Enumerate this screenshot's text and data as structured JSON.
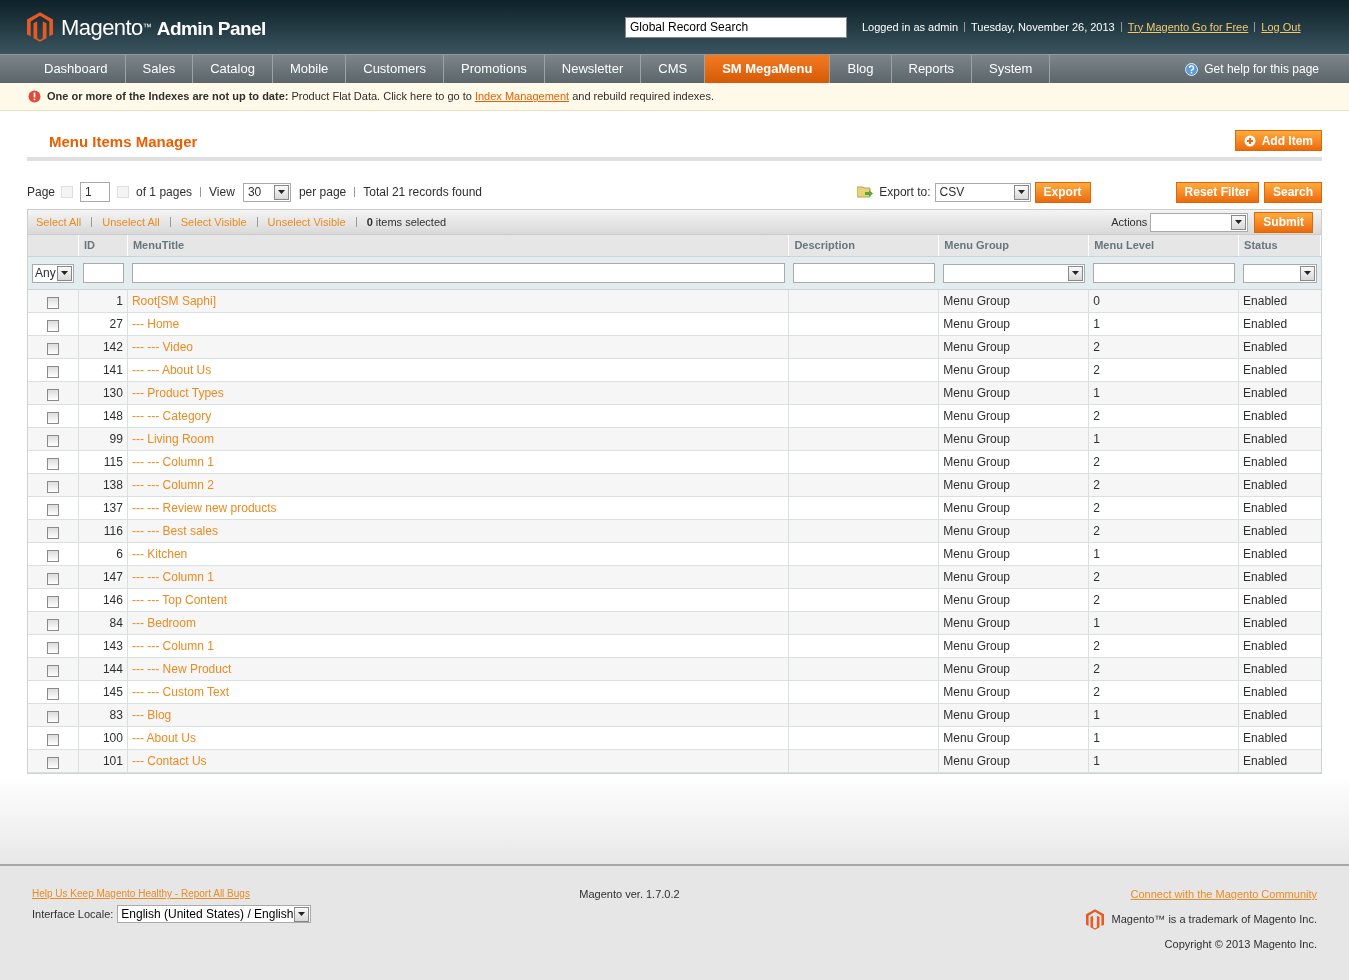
{
  "header": {
    "logo_text": "Magento",
    "logo_mark": "™",
    "logo_suffix": "Admin Panel",
    "search": {
      "value": "Global Record Search"
    },
    "user": "Logged in as admin",
    "date": "Tuesday, November 26, 2013",
    "links": [
      "Try Magento Go for Free",
      "Log Out"
    ]
  },
  "nav": {
    "items": [
      {
        "label": "Dashboard",
        "selected": false
      },
      {
        "label": "Sales",
        "selected": false
      },
      {
        "label": "Catalog",
        "selected": false
      },
      {
        "label": "Mobile",
        "selected": false
      },
      {
        "label": "Customers",
        "selected": false
      },
      {
        "label": "Promotions",
        "selected": false
      },
      {
        "label": "Newsletter",
        "selected": false
      },
      {
        "label": "CMS",
        "selected": false
      },
      {
        "label": "SM MegaMenu",
        "selected": true
      },
      {
        "label": "Blog",
        "selected": false
      },
      {
        "label": "Reports",
        "selected": false
      },
      {
        "label": "System",
        "selected": false
      }
    ],
    "help": "Get help for this page"
  },
  "notice": {
    "bold": "One or more of the Indexes are not up to date:",
    "text": "Product Flat Data. Click here to go to",
    "link": "Index Management",
    "after": "and rebuild required indexes."
  },
  "page_title": "Menu Items Manager",
  "add_button": "Add Item",
  "pager": {
    "page_label": "Page",
    "page": "1",
    "of_pages": "of 1 pages",
    "view_label": "View",
    "per_page": "30",
    "per_page_label": "per page",
    "total": "Total 21 records found"
  },
  "export": {
    "label": "Export to:",
    "format": "CSV",
    "button": "Export"
  },
  "filter_buttons": [
    "Reset Filter",
    "Search"
  ],
  "massaction": {
    "links": [
      "Select All",
      "Unselect All",
      "Select Visible",
      "Unselect Visible"
    ],
    "count": "0",
    "count_label": "items selected",
    "actions_label": "Actions",
    "submit": "Submit"
  },
  "table": {
    "columns": [
      "ID",
      "MenuTitle",
      "Description",
      "Menu Group",
      "Menu Level",
      "Status"
    ],
    "any_filter": "Any",
    "rows": [
      {
        "id": "1",
        "title": "Root[SM Saphi]",
        "group": "Menu Group",
        "level": "0",
        "status": "Enabled",
        "checked": false
      },
      {
        "id": "27",
        "title": "--- Home",
        "group": "Menu Group",
        "level": "1",
        "status": "Enabled",
        "checked": false
      },
      {
        "id": "142",
        "title": "--- --- Video",
        "group": "Menu Group",
        "level": "2",
        "status": "Enabled",
        "checked": false
      },
      {
        "id": "141",
        "title": "--- --- About Us",
        "group": "Menu Group",
        "level": "2",
        "status": "Enabled",
        "checked": false
      },
      {
        "id": "130",
        "title": "--- Product Types",
        "group": "Menu Group",
        "level": "1",
        "status": "Enabled",
        "checked": false
      },
      {
        "id": "148",
        "title": "--- --- Category",
        "group": "Menu Group",
        "level": "2",
        "status": "Enabled",
        "checked": false
      },
      {
        "id": "99",
        "title": "--- Living Room",
        "group": "Menu Group",
        "level": "1",
        "status": "Enabled",
        "checked": false
      },
      {
        "id": "115",
        "title": "--- --- Column 1",
        "group": "Menu Group",
        "level": "2",
        "status": "Enabled",
        "checked": false
      },
      {
        "id": "138",
        "title": "--- --- Column 2",
        "group": "Menu Group",
        "level": "2",
        "status": "Enabled",
        "checked": false
      },
      {
        "id": "137",
        "title": "--- --- Review new products",
        "group": "Menu Group",
        "level": "2",
        "status": "Enabled",
        "checked": false
      },
      {
        "id": "116",
        "title": "--- --- Best sales",
        "group": "Menu Group",
        "level": "2",
        "status": "Enabled",
        "checked": false
      },
      {
        "id": "6",
        "title": "--- Kitchen",
        "group": "Menu Group",
        "level": "1",
        "status": "Enabled",
        "checked": false
      },
      {
        "id": "147",
        "title": "--- --- Column 1",
        "group": "Menu Group",
        "level": "2",
        "status": "Enabled",
        "checked": false
      },
      {
        "id": "146",
        "title": "--- --- Top Content",
        "group": "Menu Group",
        "level": "2",
        "status": "Enabled",
        "checked": false
      },
      {
        "id": "84",
        "title": "--- Bedroom",
        "group": "Menu Group",
        "level": "1",
        "status": "Enabled",
        "checked": false
      },
      {
        "id": "143",
        "title": "--- --- Column 1",
        "group": "Menu Group",
        "level": "2",
        "status": "Enabled",
        "checked": false
      },
      {
        "id": "144",
        "title": "--- --- New Product",
        "group": "Menu Group",
        "level": "2",
        "status": "Enabled",
        "checked": false
      },
      {
        "id": "145",
        "title": "--- --- Custom Text",
        "group": "Menu Group",
        "level": "2",
        "status": "Enabled",
        "checked": false
      },
      {
        "id": "83",
        "title": "--- Blog",
        "group": "Menu Group",
        "level": "1",
        "status": "Enabled",
        "checked": false
      },
      {
        "id": "100",
        "title": "--- About Us",
        "group": "Menu Group",
        "level": "1",
        "status": "Enabled",
        "checked": false
      },
      {
        "id": "101",
        "title": "--- Contact Us",
        "group": "Menu Group",
        "level": "1",
        "status": "Enabled",
        "checked": false
      }
    ]
  },
  "footer": {
    "bug_link": "Help Us Keep Magento Healthy - Report All Bugs",
    "locale_label": "Interface Locale:",
    "locale": "English (United States) / English",
    "version": "Magento ver. 1.7.0.2",
    "community_link": "Connect with the Magento Community",
    "trademark": "Magento™ is a trademark of Magento Inc.",
    "copyright": "Copyright © 2013 Magento Inc."
  }
}
